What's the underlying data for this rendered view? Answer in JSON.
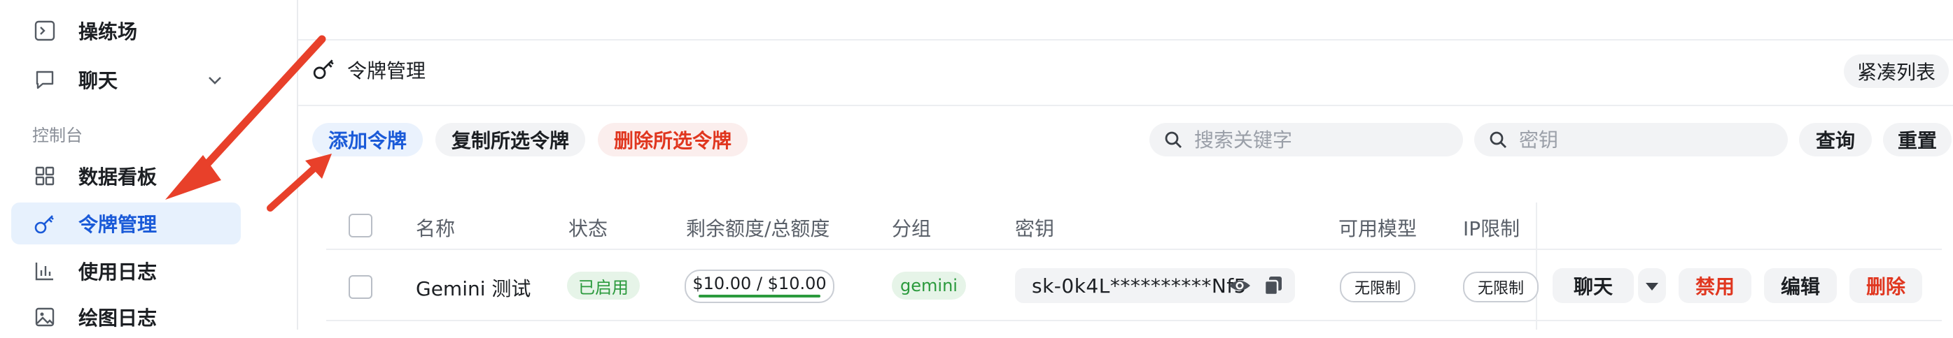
{
  "sidebar": {
    "items": [
      {
        "label": "操练场",
        "icon": "terminal-icon"
      },
      {
        "label": "聊天",
        "icon": "chat-bubble-icon"
      },
      {
        "label": "数据看板",
        "icon": "dashboard-grid-icon"
      },
      {
        "label": "令牌管理",
        "icon": "key-icon",
        "active": true
      },
      {
        "label": "使用日志",
        "icon": "bar-chart-icon"
      },
      {
        "label": "绘图日志",
        "icon": "image-icon"
      }
    ],
    "group_label": "控制台"
  },
  "header": {
    "title": "令牌管理",
    "compact_button": "紧凑列表"
  },
  "toolbar": {
    "add_label": "添加令牌",
    "copy_label": "复制所选令牌",
    "delete_label": "删除所选令牌",
    "search_keyword_placeholder": "搜索关键字",
    "search_key_placeholder": "密钥",
    "query_label": "查询",
    "reset_label": "重置"
  },
  "table": {
    "columns": [
      "名称",
      "状态",
      "剩余额度/总额度",
      "分组",
      "密钥",
      "可用模型",
      "IP限制"
    ],
    "rows": [
      {
        "name": "Gemini 测试",
        "status": "已启用",
        "quota": "$10.00 / $10.00",
        "quota_fraction": 1.0,
        "group": "gemini",
        "key": "sk-0k4L**********Nf5",
        "models": "无限制",
        "ip_limit": "无限制",
        "actions": {
          "chat": "聊天",
          "disable": "禁用",
          "edit": "编辑",
          "delete": "删除"
        }
      }
    ]
  },
  "colors": {
    "accent": "#1a5ad8",
    "danger": "#e0361f",
    "success": "#2b9a3d",
    "annotation_arrow": "#e8402a"
  }
}
